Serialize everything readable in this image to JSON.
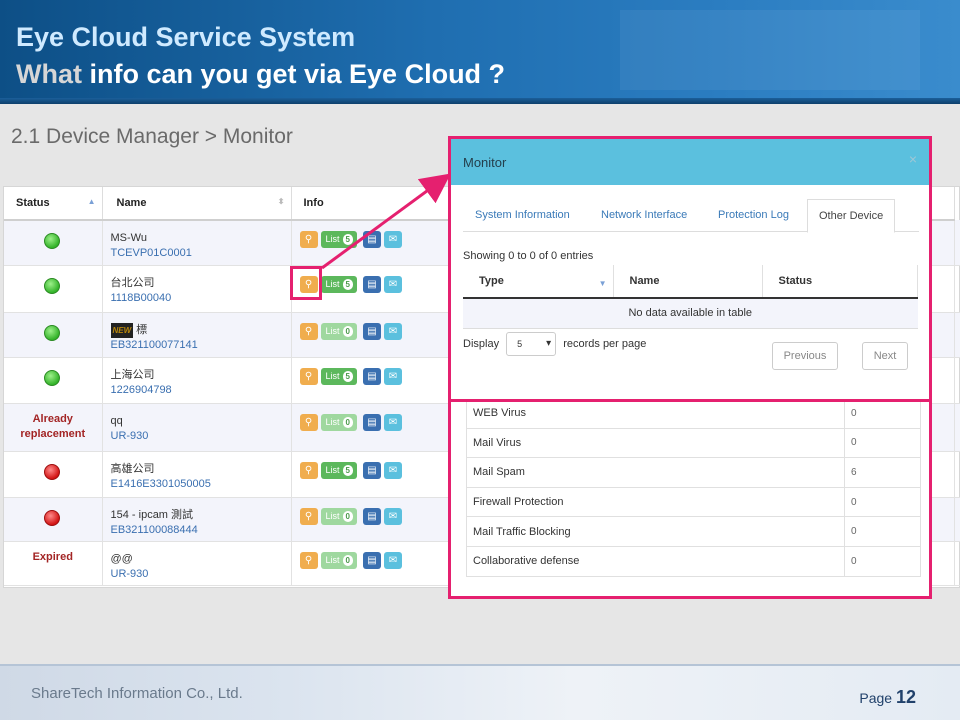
{
  "header": {
    "title_line1": "Eye Cloud Service System",
    "title_line2_prefix": "What",
    "title_line2_rest": " info can you get via Eye Cloud ?"
  },
  "subtitle": "2.1 Device Manager > Monitor",
  "device_table": {
    "columns": [
      "Status",
      "Name",
      "Info"
    ],
    "rows": [
      {
        "status": "green",
        "status_text": "",
        "name": "MS-Wu",
        "code": "TCEVP01C0001",
        "list_label": "List",
        "list_count": "5",
        "list_enabled": true
      },
      {
        "status": "green",
        "status_text": "",
        "name": "台北公司",
        "code": "1118B00040",
        "list_label": "List",
        "list_count": "5",
        "list_enabled": true
      },
      {
        "status": "green",
        "status_text": "",
        "name": "標",
        "name_badge": "NEW",
        "code": "EB321100077141",
        "list_label": "List",
        "list_count": "0",
        "list_enabled": false
      },
      {
        "status": "green",
        "status_text": "",
        "name": "上海公司",
        "code": "1226904798",
        "list_label": "List",
        "list_count": "5",
        "list_enabled": true
      },
      {
        "status": "text",
        "status_text": "Already replacement",
        "name": "qq",
        "code": "UR-930",
        "list_label": "List",
        "list_count": "0",
        "list_enabled": false
      },
      {
        "status": "red",
        "status_text": "",
        "name": "高雄公司",
        "code": "E1416E3301050005",
        "list_label": "List",
        "list_count": "5",
        "list_enabled": true
      },
      {
        "status": "red",
        "status_text": "",
        "name": "154 - ipcam 測試",
        "code": "EB321100088444",
        "list_label": "List",
        "list_count": "0",
        "list_enabled": false
      },
      {
        "status": "text",
        "status_text": "Expired",
        "name": "@@",
        "code": "UR-930",
        "list_label": "List",
        "list_count": "0",
        "list_enabled": false
      }
    ]
  },
  "stats_table": {
    "rows": [
      {
        "label": "WEB Virus",
        "value": "0"
      },
      {
        "label": "Mail Virus",
        "value": "0"
      },
      {
        "label": "Mail Spam",
        "value": "6"
      },
      {
        "label": "Firewall Protection",
        "value": "0"
      },
      {
        "label": "Mail Traffic Blocking",
        "value": "0"
      },
      {
        "label": "Collaborative defense",
        "value": "0"
      }
    ]
  },
  "modal": {
    "title": "Monitor",
    "close": "×",
    "tabs": [
      "System Information",
      "Network Interface",
      "Protection Log",
      "Other Device"
    ],
    "active_tab": "Other Device",
    "showing": "Showing 0 to 0 of 0 entries",
    "columns": [
      "Type",
      "Name",
      "Status"
    ],
    "empty": "No data available in table",
    "display_label": "Display",
    "display_value": "5",
    "records_label": "records per page",
    "prev_label": "Previous",
    "next_label": "Next"
  },
  "footer": {
    "company": "ShareTech Information Co., Ltd.",
    "page_label": "Page",
    "page_number": "12"
  },
  "colors": {
    "highlight": "#e5206f",
    "modal_header": "#5bc0de",
    "header_blue": "#1f6eb0"
  }
}
